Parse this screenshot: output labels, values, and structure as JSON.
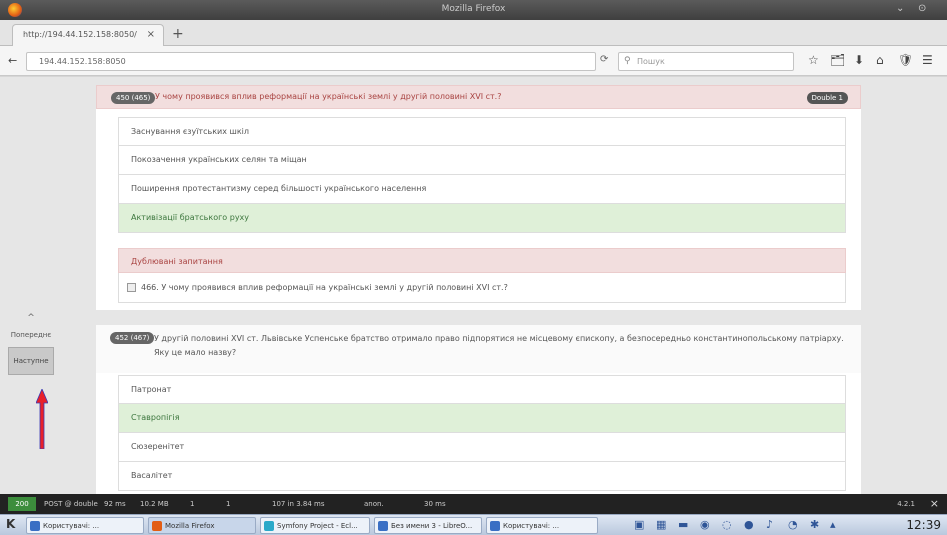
{
  "window": {
    "title": "Mozilla Firefox",
    "controls": [
      "⌄",
      "⊙"
    ]
  },
  "tab": {
    "title": "http://194.44.152.158:8050/",
    "close": "×",
    "new_tab": "+"
  },
  "navbar": {
    "back": "←",
    "url": "194.44.152.158:8050",
    "reload": "⟳",
    "search_placeholder": "Пошук",
    "icons": [
      "☆",
      "🗂",
      "⬇",
      "⌂",
      "🛡",
      "☰"
    ]
  },
  "question1": {
    "badge": "450 (465)",
    "text": "У чому проявився вплив реформації на українські землі у другій половині XVI ст.?",
    "double_badge": "Double 1",
    "answers": [
      {
        "text": "Заснування єзуїтських шкіл",
        "correct": false
      },
      {
        "text": "Покозачення українських селян та міщан",
        "correct": false
      },
      {
        "text": "Поширення протестантизму серед більшості українського населення",
        "correct": false
      },
      {
        "text": "Активізації братського руху",
        "correct": true
      }
    ],
    "duplicate_header": "Дублювані запитання",
    "duplicate_item": "466. У чому проявився вплив реформації на українські землі у другій половині XVI ст.?"
  },
  "question2": {
    "badge": "452 (467)",
    "text": "У другій половині XVI ст. Львівське Успенське братство отримало право підпорятися не місцевому єпископу, а безпосередньо константинопольському патріарху. Яку це мало назву?",
    "answers": [
      {
        "text": "Патронат",
        "correct": false
      },
      {
        "text": "Ставропігія",
        "correct": true
      },
      {
        "text": "Сюзеренітет",
        "correct": false
      },
      {
        "text": "Васалітет",
        "correct": false
      }
    ]
  },
  "sidenav": {
    "up": "^",
    "prev": "Попереднє",
    "next": "Наступне"
  },
  "debugbar": {
    "status": "200",
    "segments": [
      "POST @ double",
      "92 ms",
      "10.2 MB",
      "1",
      "1",
      "107 in 3.84 ms",
      "anon.",
      "30 ms"
    ],
    "version": "4.2.1",
    "close": "×"
  },
  "taskbar": {
    "tasks": [
      "Користувачі: ...",
      "Mozilla Firefox",
      "Symfony Project - Ecl...",
      "Без имени 3 - LibreO...",
      "Користувачі: ..."
    ],
    "clock": "12:39"
  },
  "colors": {
    "correct_bg": "#dff0d8",
    "error_bg": "#f2dede",
    "arrow": "#e8202a"
  }
}
